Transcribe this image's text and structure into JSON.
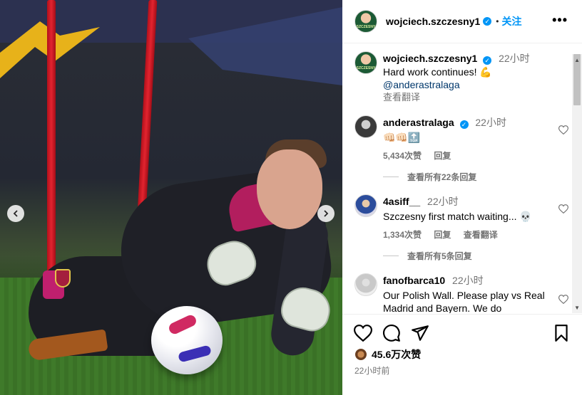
{
  "post": {
    "author": "wojciech.szczesny1",
    "avatar_text": "SZCZESNY",
    "follow_label": "关注",
    "more_label": "•••",
    "caption": {
      "author": "wojciech.szczesny1",
      "time": "22小时",
      "text": "Hard work continues! 💪",
      "mention": "@anderastralaga",
      "translate": "查看翻译"
    },
    "likes": "45.6万次赞",
    "posted_time": "22小时前"
  },
  "comments": [
    {
      "user": "anderastralaga",
      "verified": true,
      "time": "22小时",
      "text": "👊🏻👊🏻🔝",
      "likes": "5,434次赞",
      "reply": "回复",
      "translate": "",
      "view_replies": "查看所有22条回复"
    },
    {
      "user": "4asiff__",
      "verified": false,
      "time": "22小时",
      "text": "Szczesny first match waiting... 💀",
      "likes": "1,334次赞",
      "reply": "回复",
      "translate": "查看翻译",
      "view_replies": "查看所有5条回复"
    },
    {
      "user": "fanofbarca10",
      "verified": false,
      "time": "22小时",
      "text": "Our Polish Wall. Please play vs Real Madrid and Bayern. We do",
      "likes": "",
      "reply": "",
      "translate": "",
      "view_replies": ""
    }
  ],
  "icons": {
    "prev": "chevron-left-icon",
    "next": "chevron-right-icon",
    "like": "heart-icon",
    "comment": "comment-icon",
    "share": "share-icon",
    "save": "bookmark-icon"
  },
  "colors": {
    "accent": "#0095f6",
    "muted": "#737373",
    "mention": "#00376b"
  }
}
